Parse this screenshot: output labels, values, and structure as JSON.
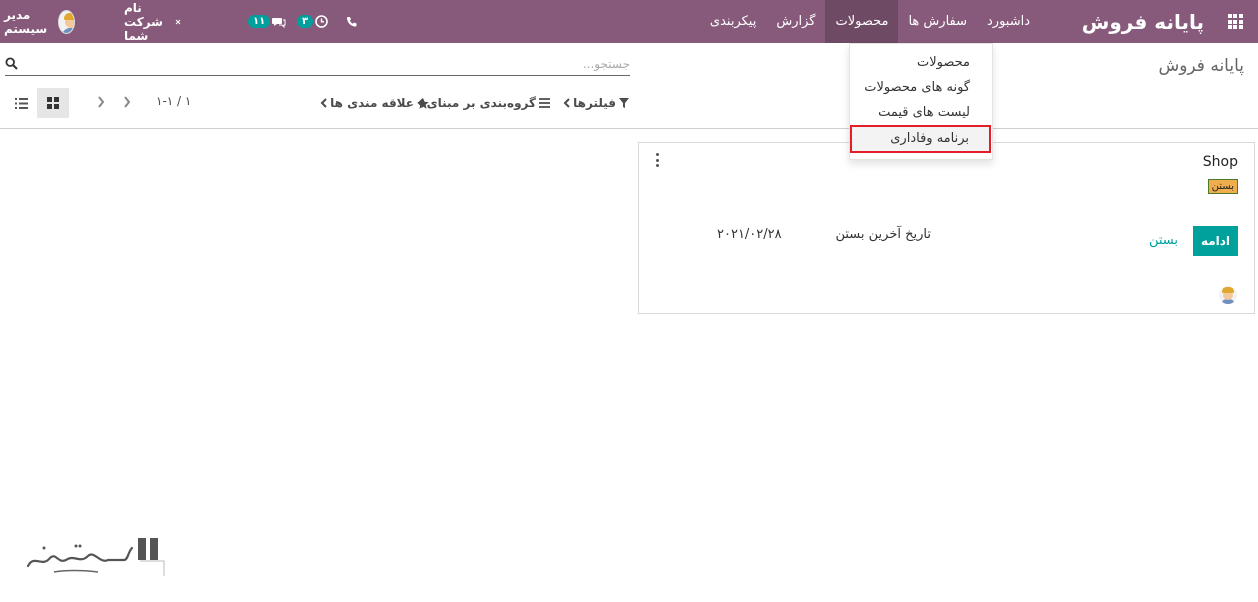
{
  "colors": {
    "brand": "#875a7b",
    "accent": "#00a09d",
    "highlight_border": "#e41e26",
    "badge_bg": "#f0ad4e"
  },
  "navbar": {
    "brand": "پایانه فروش",
    "apps_icon": "grid-icon",
    "menu": [
      {
        "label": "داشبورد",
        "active": false
      },
      {
        "label": "سفارش ها",
        "active": false
      },
      {
        "label": "محصولات",
        "active": true
      },
      {
        "label": "گزارش",
        "active": false
      },
      {
        "label": "پیکربندی",
        "active": false
      }
    ],
    "systray": {
      "user_name": "مدیر سیستم",
      "company_name": "نام شرکت شما",
      "messages_count": "۱۱",
      "activities_count": "۳"
    }
  },
  "dropdown": {
    "items": [
      {
        "label": "محصولات"
      },
      {
        "label": "گونه های محصولات"
      },
      {
        "label": "لیست های قیمت"
      },
      {
        "label": "برنامه وفاداری"
      }
    ]
  },
  "control_panel": {
    "breadcrumb": "پایانه فروش",
    "search_placeholder": "جستجو...",
    "filters_label": "فیلترها",
    "groupby_label": "گروه‌بندی بر مبنای",
    "favorites_label": "علاقه مندی ها",
    "pager": "۱-۱ / ۱"
  },
  "card": {
    "title": "Shop",
    "status": "بستن",
    "resume_label": "ادامه",
    "close_label": "بستن",
    "last_close_label": "تاریخ آخرین بستن",
    "last_close_date": "۲۰۲۱/۰۲/۲۸"
  }
}
